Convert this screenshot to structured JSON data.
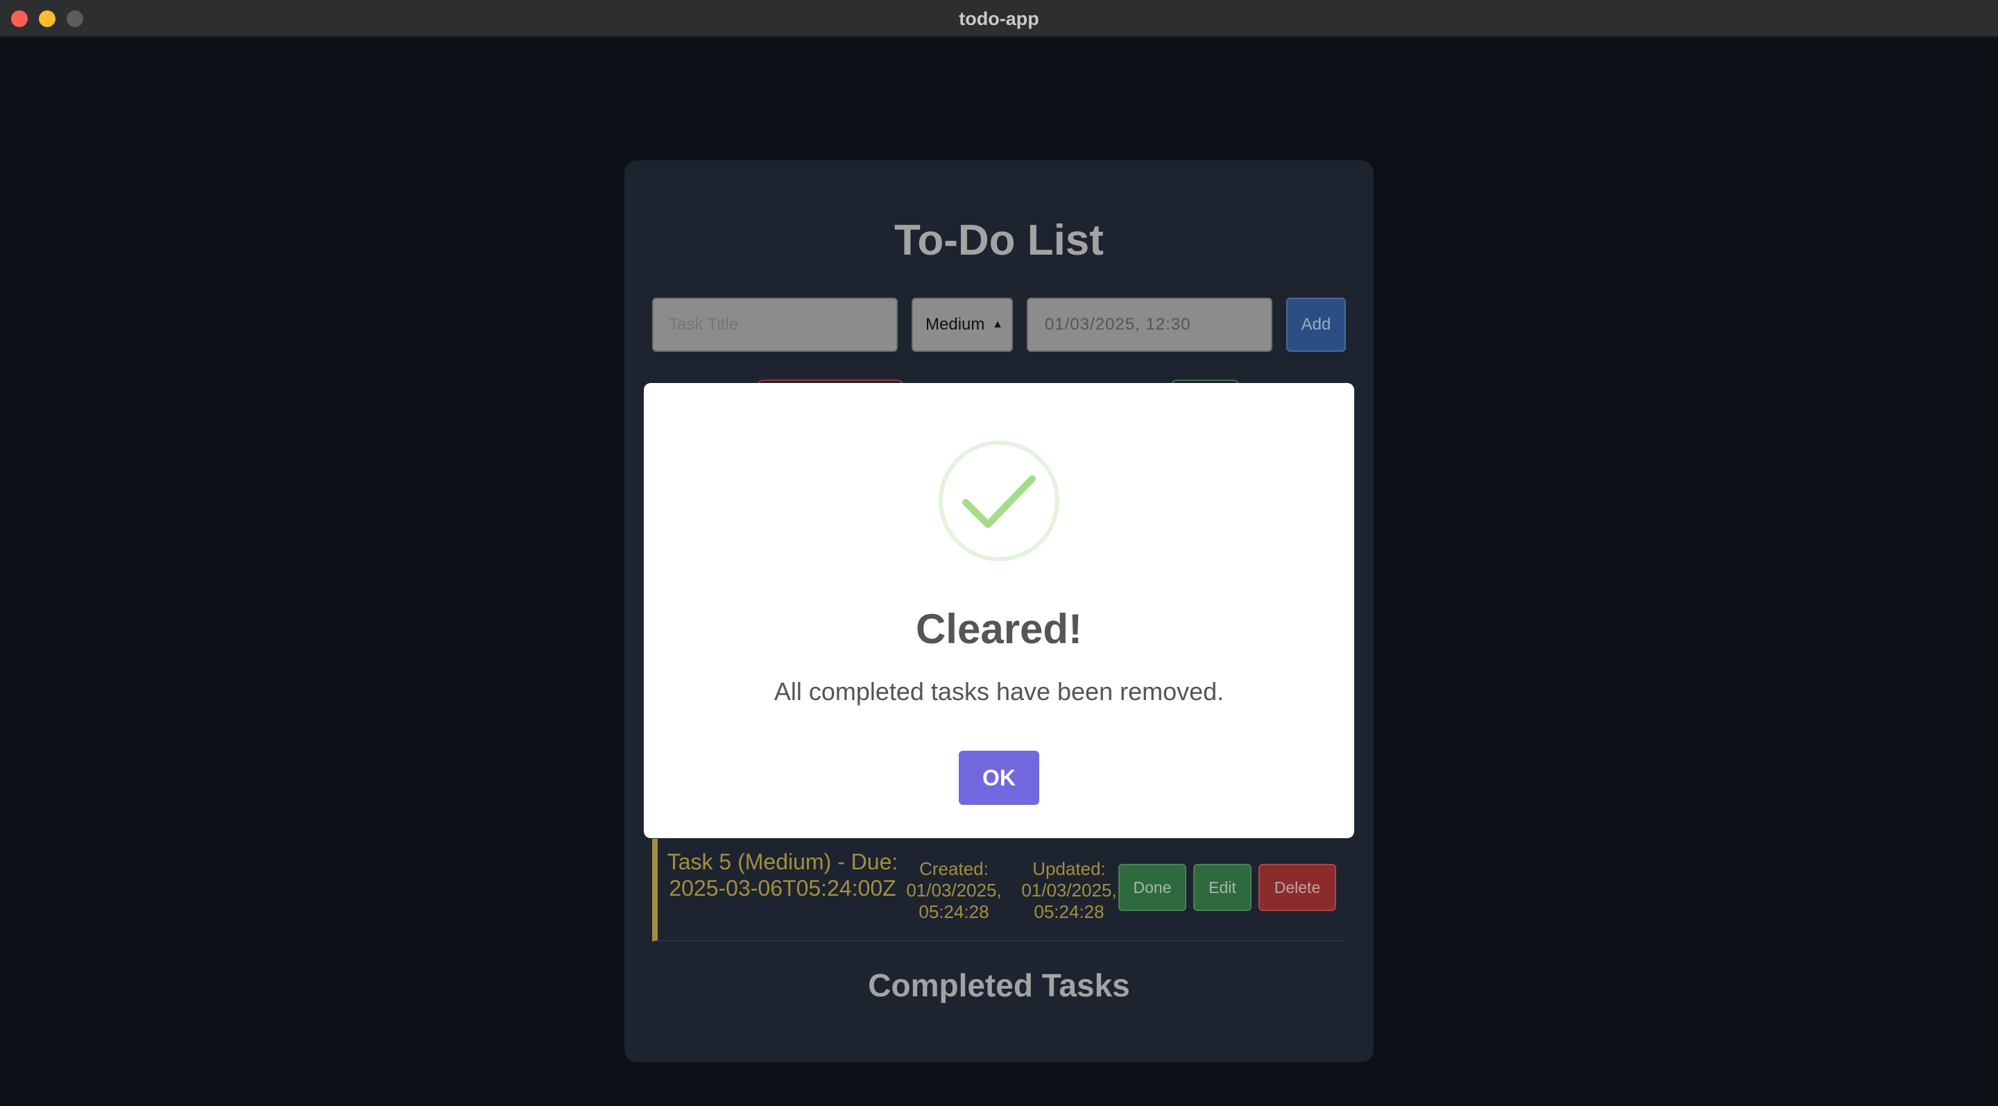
{
  "window": {
    "title": "todo-app"
  },
  "app": {
    "title": "To-Do List",
    "task_input_placeholder": "Task Title",
    "priority_selected": "Medium",
    "datetime_value": "01/03/2025, 12:30",
    "add_label": "Add"
  },
  "tasks": [
    {
      "title": "Task 5 (Medium) - Due: 2025-03-06T05:24:00Z",
      "created": "Created: 01/03/2025, 05:24:28",
      "updated": "Updated: 01/03/2025, 05:24:28",
      "done_label": "Done",
      "edit_label": "Edit",
      "delete_label": "Delete",
      "priority_color": "#a0903e"
    }
  ],
  "completed_heading": "Completed Tasks",
  "modal": {
    "icon": "success-check-icon",
    "title": "Cleared!",
    "text": "All completed tasks have been removed.",
    "ok_label": "OK",
    "accent_color": "#7367e0"
  }
}
